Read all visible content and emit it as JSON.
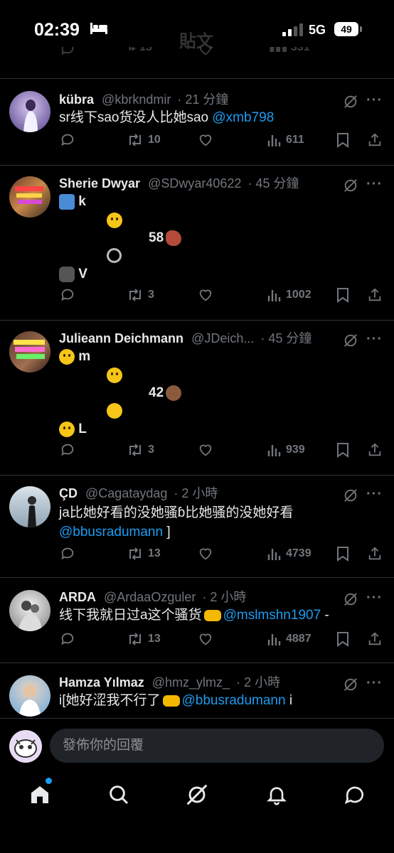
{
  "status_bar": {
    "time": "02:39",
    "network": "5G",
    "battery": "49"
  },
  "header_ghost": {
    "title": "貼文"
  },
  "ghost_row": {
    "retweets": "15",
    "views": "331"
  },
  "tweets": [
    {
      "name": "kübra",
      "handle": "@kbrkndmir",
      "time": "· 21 分鐘",
      "text": "sr线下sao货没人比她sao ",
      "mention": "@xmb798",
      "replies": "",
      "retweets": "10",
      "likes": "",
      "views": "611"
    },
    {
      "name": "Sherie Dwyar",
      "handle": "@SDwyar40622",
      "time": "· 45 分鐘",
      "line1": "k",
      "line3": "58",
      "line5": "V",
      "replies": "",
      "retweets": "3",
      "likes": "",
      "views": "1002"
    },
    {
      "name": "Julieann Deichmann",
      "handle": "@JDeich...",
      "time": "· 45 分鐘",
      "line1": "m",
      "line3": "42",
      "line5": "L",
      "replies": "",
      "retweets": "3",
      "likes": "",
      "views": "939"
    },
    {
      "name": "ÇD",
      "handle": "@Cagataydag",
      "time": "· 2 小時",
      "text": "ja比她好看的没她骚ɓ比她骚的没她好看",
      "mention": "@bbusradumann",
      "suffix": " ]",
      "replies": "",
      "retweets": "13",
      "likes": "",
      "views": "4739"
    },
    {
      "name": "ARDA",
      "handle": "@ArdaaOzguler",
      "time": "· 2 小時",
      "text": "线下我就日过a这个骚货",
      "mention": "@mslmshn1907",
      "suffix": " -",
      "replies": "",
      "retweets": "13",
      "likes": "",
      "views": "4887"
    },
    {
      "name": "Hamza Yılmaz",
      "handle": "@hmz_ylmz_",
      "time": "· 2 小時",
      "text": "i[她好涩我不行了",
      "mention": "@bbusradumann",
      "suffix": " i"
    }
  ],
  "reply_bar": {
    "placeholder": "發佈你的回覆"
  },
  "colors": {
    "accent": "#1d9bf0",
    "background": "#000000",
    "muted": "#71767b"
  },
  "icons": [
    "reply-icon",
    "retweet-icon",
    "like-icon",
    "views-icon",
    "bookmark-icon",
    "share-icon",
    "grok-icon",
    "more-icon",
    "home-icon",
    "search-icon",
    "notifications-icon",
    "messages-icon"
  ]
}
